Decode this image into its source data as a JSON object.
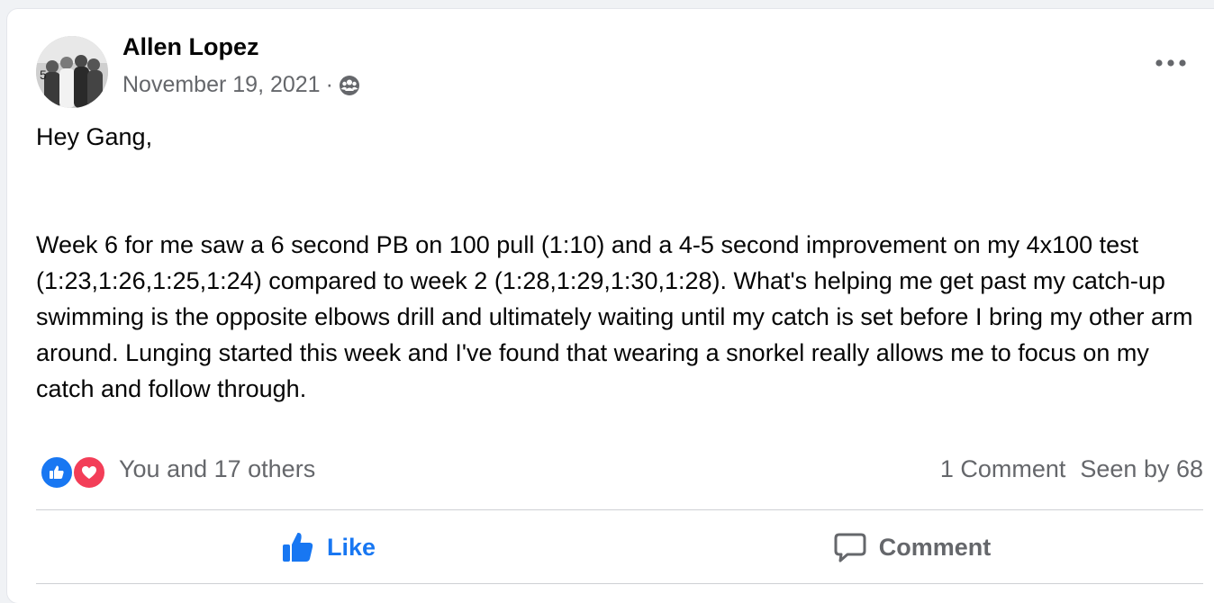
{
  "post": {
    "author": "Allen Lopez",
    "date": "November 19, 2021",
    "separator": "·",
    "privacy_icon": "group-icon",
    "more_icon": "more-options-icon",
    "paragraphs": [
      "Hey Gang,",
      "Week 6 for me saw a 6 second PB on 100 pull (1:10) and a 4-5 second improvement on my 4x100 test (1:23,1:26,1:25,1:24) compared to week 2 (1:28,1:29,1:30,1:28). What's helping me get past my catch-up swimming is the opposite elbows drill and ultimately waiting until my catch is set before I bring my other arm around. Lunging started this week and I've found that wearing a snorkel really allows me to focus on my catch and follow through."
    ]
  },
  "reactions": {
    "icons": [
      "like-reaction-icon",
      "love-reaction-icon"
    ],
    "summary": "You and 17 others",
    "comments": "1 Comment",
    "seen": "Seen by 68"
  },
  "actions": {
    "like_label": "Like",
    "comment_label": "Comment"
  },
  "colors": {
    "accent": "#1877f2",
    "secondary_text": "#65676b",
    "love": "#f33e58",
    "divider": "#ced0d4"
  }
}
